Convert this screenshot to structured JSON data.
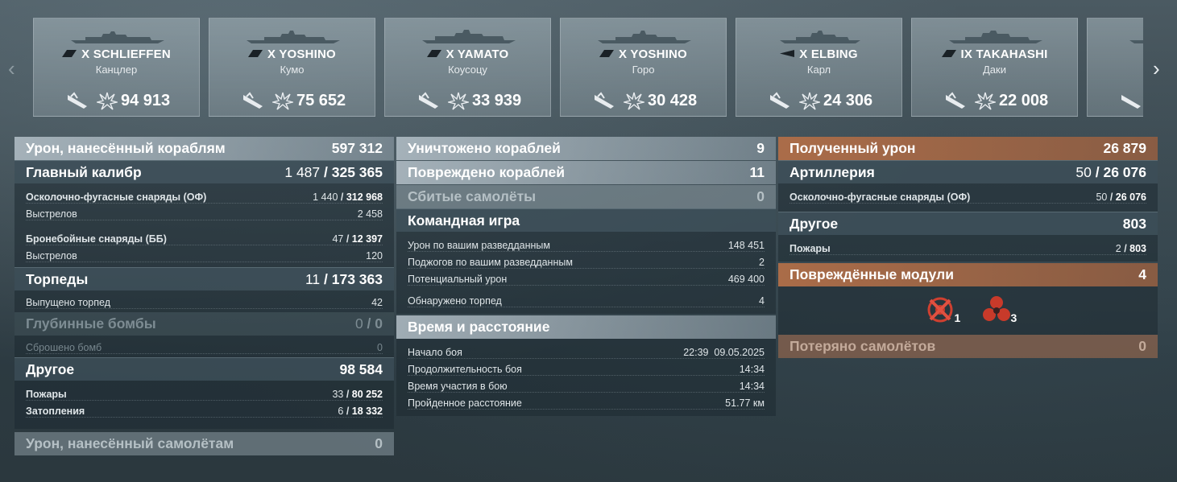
{
  "nav": {
    "prev": "‹",
    "next": "›"
  },
  "ships": [
    {
      "tier_name": "X SCHLIEFFEN",
      "player": "Канцлер",
      "damage": "94 913"
    },
    {
      "tier_name": "X YOSHINO",
      "player": "Кумо",
      "damage": "75 652"
    },
    {
      "tier_name": "X YAMATO",
      "player": "Коусоцу",
      "damage": "33 939"
    },
    {
      "tier_name": "X YOSHINO",
      "player": "Горо",
      "damage": "30 428"
    },
    {
      "tier_name": "X ELBING",
      "player": "Карл",
      "damage": "24 306"
    },
    {
      "tier_name": "IX TAKAHASHI",
      "player": "Даки",
      "damage": "22 008"
    }
  ],
  "left": {
    "damage_ships": {
      "label": "Урон, нанесённый кораблям",
      "value": "597 312"
    },
    "main_battery": {
      "label": "Главный калибр",
      "hits": "1 487",
      "dmg": "325 365"
    },
    "he": {
      "label": "Осколочно-фугасные снаряды (ОФ)",
      "hits": "1 440",
      "dmg": "312 968"
    },
    "he_shots": {
      "label": "Выстрелов",
      "value": "2 458"
    },
    "ap": {
      "label": "Бронебойные снаряды (ББ)",
      "hits": "47",
      "dmg": "12 397"
    },
    "ap_shots": {
      "label": "Выстрелов",
      "value": "120"
    },
    "torpedoes": {
      "label": "Торпеды",
      "hits": "11",
      "dmg": "173 363"
    },
    "torp_launched": {
      "label": "Выпущено торпед",
      "value": "42"
    },
    "depth": {
      "label": "Глубинные бомбы",
      "hits": "0",
      "dmg": "0"
    },
    "bombs_dropped": {
      "label": "Сброшено бомб",
      "value": "0"
    },
    "other": {
      "label": "Другое",
      "value": "98 584"
    },
    "fires": {
      "label": "Пожары",
      "hits": "33",
      "dmg": "80 252"
    },
    "floods": {
      "label": "Затопления",
      "hits": "6",
      "dmg": "18 332"
    },
    "aircraft_dmg": {
      "label": "Урон, нанесённый самолётам",
      "value": "0"
    }
  },
  "middle": {
    "destroyed": {
      "label": "Уничтожено кораблей",
      "value": "9"
    },
    "damaged": {
      "label": "Повреждено кораблей",
      "value": "11"
    },
    "planes": {
      "label": "Сбитые самолёты",
      "value": "0"
    },
    "team": {
      "label": "Командная игра"
    },
    "team_rows": [
      {
        "label": "Урон по вашим разведданным",
        "value": "148 451"
      },
      {
        "label": "Поджогов по вашим разведданным",
        "value": "2"
      },
      {
        "label": "Потенциальный урон",
        "value": "469 400"
      },
      {
        "label": "Обнаружено торпед",
        "value": "4"
      }
    ],
    "time": {
      "label": "Время и расстояние"
    },
    "time_rows": [
      {
        "label": "Начало боя",
        "value": "22:39  09.05.2025"
      },
      {
        "label": "Продолжительность боя",
        "value": "14:34"
      },
      {
        "label": "Время участия в бою",
        "value": "14:34"
      },
      {
        "label": "Пройденное расстояние",
        "value": "51.77 км"
      }
    ]
  },
  "right": {
    "received": {
      "label": "Полученный урон",
      "value": "26 879"
    },
    "artillery": {
      "label": "Артиллерия",
      "hits": "50",
      "dmg": "26 076"
    },
    "r_he": {
      "label": "Осколочно-фугасные снаряды (ОФ)",
      "hits": "50",
      "dmg": "26 076"
    },
    "r_other": {
      "label": "Другое",
      "value": "803"
    },
    "r_fires": {
      "label": "Пожары",
      "hits": "2",
      "dmg": "803"
    },
    "modules": {
      "label": "Повреждённые модули",
      "value": "4"
    },
    "module_icons": [
      {
        "icon": "steering-gear-icon",
        "count": "1"
      },
      {
        "icon": "propeller-icon",
        "count": "3"
      }
    ],
    "lost_planes": {
      "label": "Потеряно самолётов",
      "value": "0"
    }
  },
  "colors": {
    "accent_orange": "#b06e48",
    "panel_light": "#bccad2",
    "text": "#ffffff"
  }
}
